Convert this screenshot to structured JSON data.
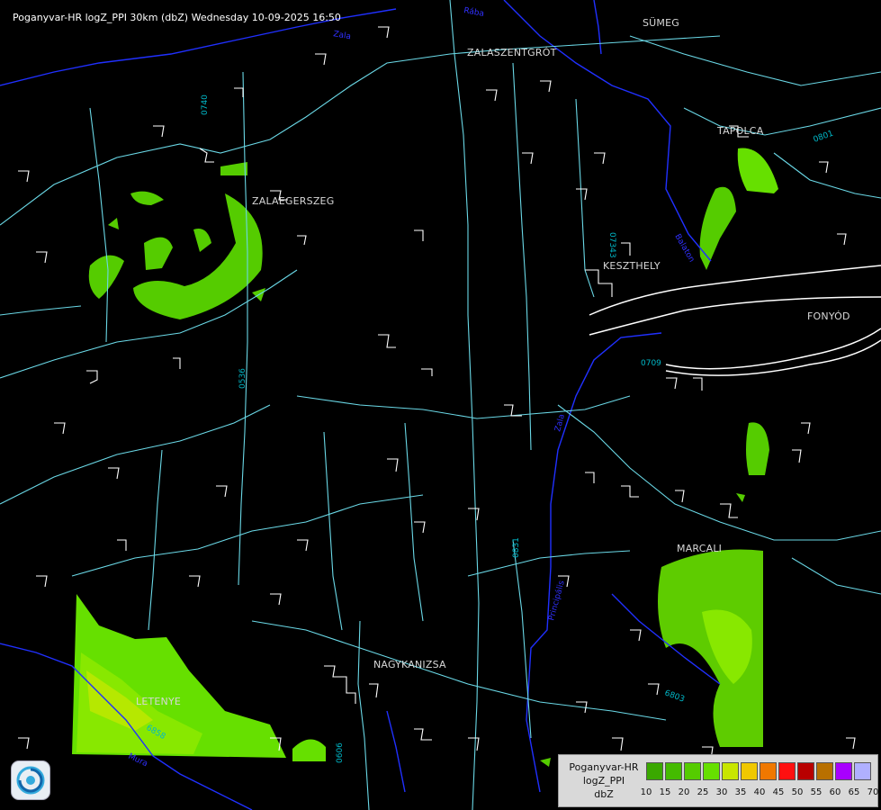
{
  "title": "Poganyvar-HR logZ_PPI 30km (dbZ) Wednesday 10-09-2025 16:50",
  "cities": [
    {
      "name": "SÜMEG"
    },
    {
      "name": "ZALASZENTGRÓT"
    },
    {
      "name": "TAPOLCA"
    },
    {
      "name": "ZALAEGERSZEG"
    },
    {
      "name": "KESZTHELY"
    },
    {
      "name": "FONYÓD"
    },
    {
      "name": "MARCALI"
    },
    {
      "name": "NAGYKANIZSA"
    },
    {
      "name": "LETENYE"
    }
  ],
  "road_numbers": [
    "0740",
    "07343",
    "0536",
    "0831",
    "6803",
    "6858",
    "0606",
    "0801",
    "0709"
  ],
  "river_labels": [
    "Zala",
    "Balaton",
    "Zala",
    "Principális",
    "Mura",
    "Rába"
  ],
  "legend": {
    "line1": "Poganyvar-HR",
    "line2": "logZ_PPI",
    "line3": "dbZ",
    "colors": [
      "#3aa800",
      "#44bb00",
      "#55cc00",
      "#66e000",
      "#c8e600",
      "#f0c800",
      "#f07800",
      "#ff1010",
      "#b80000",
      "#b87000",
      "#a800ff",
      "#b0b0ff"
    ],
    "ticks": [
      "10",
      "15",
      "20",
      "25",
      "30",
      "35",
      "40",
      "45",
      "50",
      "55",
      "60",
      "65",
      "70"
    ]
  },
  "logo": {
    "icon": "radar-logo-icon"
  }
}
